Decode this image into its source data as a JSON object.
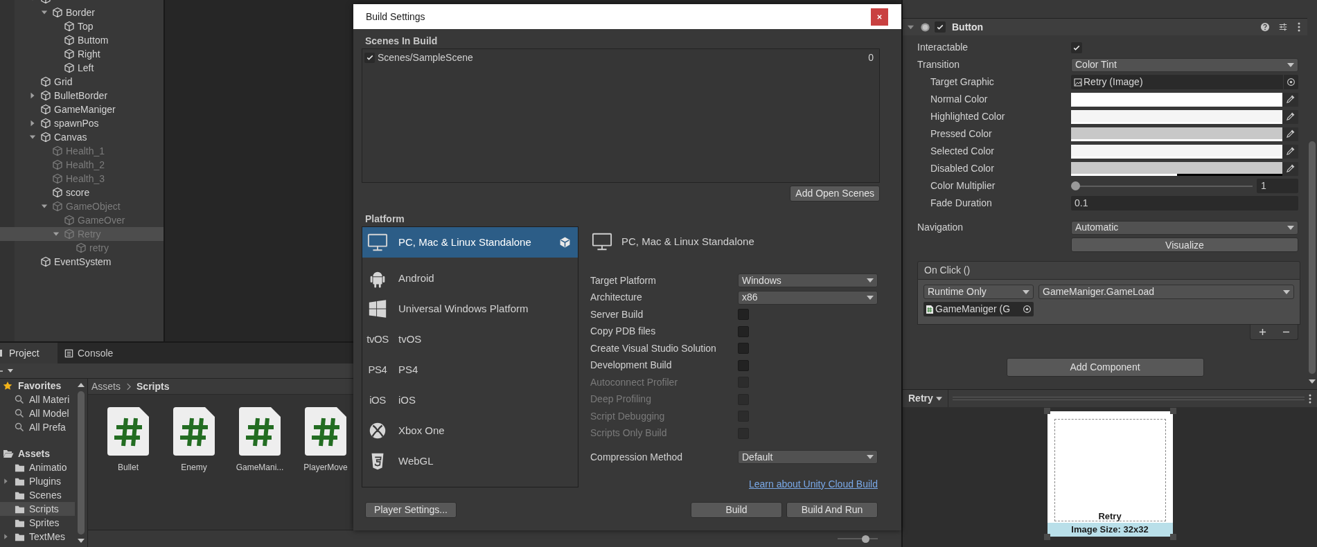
{
  "hierarchy": {
    "items": [
      {
        "kind": "group",
        "expanded": true,
        "disabled": false,
        "selected": false,
        "children": [
          {
            "name": "Border",
            "kind": "group",
            "expanded": true,
            "disabled": false,
            "selected": false,
            "children": [
              {
                "name": "Top",
                "kind": "leaf",
                "disabled": false,
                "selected": false
              },
              {
                "name": "Buttom",
                "kind": "leaf",
                "disabled": false,
                "selected": false
              },
              {
                "name": "Right",
                "kind": "leaf",
                "disabled": false,
                "selected": false
              },
              {
                "name": "Left",
                "kind": "leaf",
                "disabled": false,
                "selected": false
              }
            ]
          }
        ]
      },
      {
        "name": "Grid",
        "kind": "leaf",
        "disabled": false,
        "selected": false
      },
      {
        "name": "BulletBorder",
        "kind": "group",
        "expanded": false,
        "disabled": false,
        "selected": false
      },
      {
        "name": "GameManiger",
        "kind": "leaf",
        "disabled": false,
        "selected": false
      },
      {
        "name": "spawnPos",
        "kind": "group",
        "expanded": false,
        "disabled": false,
        "selected": false
      },
      {
        "name": "Canvas",
        "kind": "group",
        "expanded": true,
        "disabled": false,
        "selected": false,
        "children": [
          {
            "name": "Health_1",
            "kind": "leaf",
            "disabled": true,
            "selected": false
          },
          {
            "name": "Health_2",
            "kind": "leaf",
            "disabled": true,
            "selected": false
          },
          {
            "name": "Health_3",
            "kind": "leaf",
            "disabled": true,
            "selected": false
          },
          {
            "name": "score",
            "kind": "leaf",
            "disabled": false,
            "selected": false
          },
          {
            "name": "GameObject",
            "kind": "group",
            "expanded": true,
            "disabled": true,
            "selected": false,
            "children": [
              {
                "name": "GameOver",
                "kind": "leaf",
                "disabled": true,
                "selected": false
              },
              {
                "name": "Retry",
                "kind": "group",
                "expanded": true,
                "disabled": true,
                "selected": true,
                "children": [
                  {
                    "name": "retry",
                    "kind": "leaf",
                    "disabled": true,
                    "selected": false
                  }
                ]
              }
            ]
          }
        ]
      },
      {
        "name": "EventSystem",
        "kind": "leaf",
        "disabled": false,
        "selected": false
      }
    ]
  },
  "project": {
    "tabs": [
      {
        "label": "Project",
        "kind": "project",
        "selected": true
      },
      {
        "label": "Console",
        "kind": "console",
        "selected": false
      }
    ],
    "favorites": {
      "label": "Favorites",
      "searches": [
        "All Materi",
        "All Model",
        "All Prefa"
      ]
    },
    "assets": {
      "label": "Assets",
      "folders": [
        {
          "name": "Animatio",
          "kind": "leaf",
          "selected": false
        },
        {
          "name": "Plugins",
          "kind": "group",
          "expanded": false,
          "selected": false
        },
        {
          "name": "Scenes",
          "kind": "leaf",
          "selected": false
        },
        {
          "name": "Scripts",
          "kind": "leaf",
          "selected": true
        },
        {
          "name": "Sprites",
          "kind": "leaf",
          "selected": false
        },
        {
          "name": "TextMes",
          "kind": "group",
          "expanded": false,
          "selected": false
        }
      ]
    },
    "breadcrumb": [
      "Assets",
      "Scripts"
    ],
    "zoom": {
      "level": 0.75
    },
    "files": [
      {
        "name": "Bullet",
        "kind": "script"
      },
      {
        "name": "Enemy",
        "kind": "script"
      },
      {
        "name": "GameMani...",
        "kind": "script"
      },
      {
        "name": "PlayerMove",
        "kind": "script"
      }
    ]
  },
  "build_settings": {
    "title": "Build Settings",
    "scenes_label": "Scenes In Build",
    "scenes": [
      {
        "path": "Scenes/SampleScene",
        "index": "0",
        "checked": true
      }
    ],
    "add_open_scenes": "Add Open Scenes",
    "platform_label": "Platform",
    "platforms": [
      {
        "name": "PC, Mac & Linux Standalone",
        "kind": "monitor",
        "selected": true,
        "current": true
      },
      {
        "name": "Android",
        "kind": "android",
        "selected": false,
        "current": false
      },
      {
        "name": "Universal Windows Platform",
        "kind": "windows",
        "selected": false,
        "current": false
      },
      {
        "name": "tvOS",
        "kind": "logo",
        "logo": "tvOS",
        "selected": false,
        "current": false
      },
      {
        "name": "PS4",
        "kind": "logo",
        "logo": "PS4",
        "selected": false,
        "current": false
      },
      {
        "name": "iOS",
        "kind": "logo",
        "logo": "iOS",
        "selected": false,
        "current": false
      },
      {
        "name": "Xbox One",
        "kind": "xbox",
        "selected": false,
        "current": false
      },
      {
        "name": "WebGL",
        "kind": "html5",
        "selected": false,
        "current": false
      }
    ],
    "target": "PC, Mac & Linux Standalone",
    "settings": [
      {
        "label": "Target Platform",
        "kind": "dropdown",
        "value": "Windows",
        "disabled": false
      },
      {
        "label": "Architecture",
        "kind": "dropdown",
        "value": "x86",
        "disabled": false
      },
      {
        "label": "Server Build",
        "kind": "checkbox",
        "checked": false,
        "disabled": false
      },
      {
        "label": "Copy PDB files",
        "kind": "checkbox",
        "checked": false,
        "disabled": false
      },
      {
        "label": "Create Visual Studio Solution",
        "kind": "checkbox",
        "checked": false,
        "disabled": false
      },
      {
        "label": "Development Build",
        "kind": "checkbox",
        "checked": false,
        "disabled": false
      },
      {
        "label": "Autoconnect Profiler",
        "kind": "checkbox",
        "checked": false,
        "disabled": true
      },
      {
        "label": "Deep Profiling",
        "kind": "checkbox",
        "checked": false,
        "disabled": true
      },
      {
        "label": "Script Debugging",
        "kind": "checkbox",
        "checked": false,
        "disabled": true
      },
      {
        "label": "Scripts Only Build",
        "kind": "checkbox",
        "checked": false,
        "disabled": true
      },
      {
        "label": "Compression Method",
        "kind": "dropdown",
        "value": "Default",
        "disabled": false
      }
    ],
    "cloud_link": "Learn about Unity Cloud Build",
    "player_settings": "Player Settings...",
    "build": "Build",
    "build_and_run": "Build And Run"
  },
  "inspector": {
    "component": {
      "title": "Button",
      "enabled": true,
      "expanded": true,
      "properties": [
        {
          "label": "Interactable",
          "kind": "checkbox",
          "checked": true
        },
        {
          "label": "Transition",
          "kind": "dropdown",
          "value": "Color Tint",
          "children": [
            {
              "label": "Target Graphic",
              "kind": "object",
              "value": "Retry (Image)"
            },
            {
              "label": "Normal Color",
              "kind": "color",
              "color": "#ffffff",
              "level": 1
            },
            {
              "label": "Highlighted Color",
              "kind": "color",
              "color": "#f5f5f5",
              "level": 1
            },
            {
              "label": "Pressed Color",
              "kind": "color",
              "color": "#c8c8c8",
              "level": 1
            },
            {
              "label": "Selected Color",
              "kind": "color",
              "color": "#f5f5f5",
              "level": 1
            },
            {
              "label": "Disabled Color",
              "kind": "color",
              "color": "#c8c8c8",
              "level": 0.5
            },
            {
              "label": "Color Multiplier",
              "kind": "slider",
              "level": 0,
              "value": "1"
            },
            {
              "label": "Fade Duration",
              "kind": "field",
              "value": "0.1"
            }
          ]
        },
        {
          "label": "Navigation",
          "kind": "dropdown",
          "value": "Automatic"
        },
        {
          "label": "Visualize",
          "kind": "button"
        }
      ],
      "on_click": {
        "title": "On Click ()",
        "mode": "Runtime Only",
        "function": "GameManiger.GameLoad",
        "target": "GameManiger (G"
      }
    },
    "add_component": "Add Component",
    "preview": {
      "title": "Retry",
      "caption": "Retry",
      "size": "Image Size: 32x32"
    }
  }
}
